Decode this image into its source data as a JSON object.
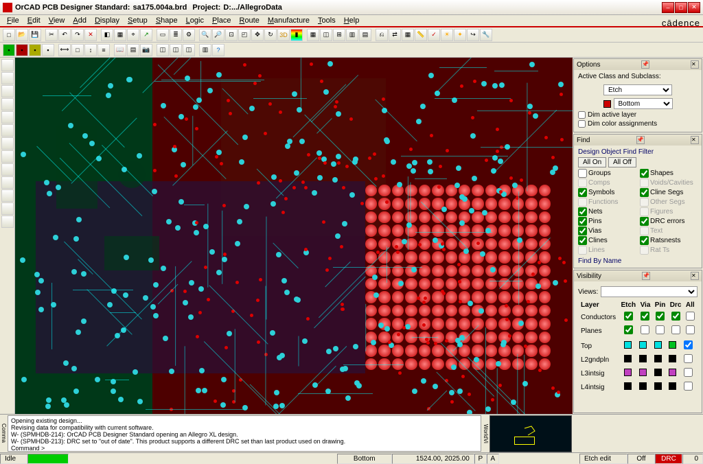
{
  "title": {
    "app": "OrCAD PCB Designer Standard:",
    "file": "sa175.004a.brd",
    "project_label": "Project:",
    "project_path": "D:.../AllegroData"
  },
  "brand": "cādence",
  "menu": [
    "File",
    "Edit",
    "View",
    "Add",
    "Display",
    "Setup",
    "Shape",
    "Logic",
    "Place",
    "Route",
    "Manufacture",
    "Tools",
    "Help"
  ],
  "options": {
    "title": "Options",
    "active_label": "Active Class and Subclass:",
    "class_value": "Etch",
    "subclass_value": "Bottom",
    "dim_active": "Dim active layer",
    "dim_color": "Dim color assignments"
  },
  "find": {
    "title": "Find",
    "filter_title": "Design Object Find Filter",
    "all_on": "All On",
    "all_off": "All Off",
    "items": [
      {
        "label": "Groups",
        "on": false,
        "enabled": true
      },
      {
        "label": "Shapes",
        "on": true,
        "enabled": true
      },
      {
        "label": "Comps",
        "on": false,
        "enabled": false
      },
      {
        "label": "Voids/Cavities",
        "on": false,
        "enabled": false
      },
      {
        "label": "Symbols",
        "on": true,
        "enabled": true
      },
      {
        "label": "Cline Segs",
        "on": true,
        "enabled": true
      },
      {
        "label": "Functions",
        "on": false,
        "enabled": false
      },
      {
        "label": "Other Segs",
        "on": false,
        "enabled": false
      },
      {
        "label": "Nets",
        "on": true,
        "enabled": true
      },
      {
        "label": "Figures",
        "on": false,
        "enabled": false
      },
      {
        "label": "Pins",
        "on": true,
        "enabled": true
      },
      {
        "label": "DRC errors",
        "on": true,
        "enabled": true
      },
      {
        "label": "Vias",
        "on": true,
        "enabled": true
      },
      {
        "label": "Text",
        "on": false,
        "enabled": false
      },
      {
        "label": "Clines",
        "on": true,
        "enabled": true
      },
      {
        "label": "Ratsnests",
        "on": true,
        "enabled": true
      },
      {
        "label": "Lines",
        "on": false,
        "enabled": false
      },
      {
        "label": "Rat Ts",
        "on": false,
        "enabled": false
      }
    ],
    "find_by_name": "Find By Name"
  },
  "visibility": {
    "title": "Visibility",
    "views_label": "Views:",
    "layer_label": "Layer",
    "cols": [
      "Etch",
      "Via",
      "Pin",
      "Drc",
      "All"
    ],
    "rows": [
      {
        "label": "Conductors",
        "checks": [
          true,
          true,
          true,
          true,
          false
        ]
      },
      {
        "label": "Planes",
        "checks": [
          true,
          false,
          false,
          false,
          false
        ]
      }
    ],
    "layers": [
      {
        "name": "Top",
        "colors": [
          "#00e0e0",
          "#00e0e0",
          "#00e0e0",
          "#00c020"
        ],
        "on": true
      },
      {
        "name": "L2gndpln",
        "colors": [
          "#000",
          "#000",
          "#000",
          "#000"
        ],
        "on": false
      },
      {
        "name": "L3intsig",
        "colors": [
          "#c040c0",
          "#c040c0",
          "#000",
          "#c040c0"
        ],
        "on": false
      },
      {
        "name": "L4intsig",
        "colors": [
          "#000",
          "#000",
          "#000",
          "#000"
        ],
        "on": false
      }
    ]
  },
  "console": {
    "lines": [
      "Opening existing design...",
      "Revising data for compatibility with current software.",
      "W- (SPMHDB-214): OrCAD PCB Designer Standard opening an Allegro XL design.",
      "W- (SPMHDB-213): DRC set to \"out of date\". This product supports a different DRC set than last product used on drawing."
    ],
    "command_prompt": "Command >"
  },
  "status": {
    "idle": "Idle",
    "layer": "Bottom",
    "coords": "1524.00, 2025.00",
    "p": "P",
    "a": "A",
    "etch_edit": "Etch edit",
    "off": "Off",
    "drc": "DRC",
    "zero": "0"
  }
}
